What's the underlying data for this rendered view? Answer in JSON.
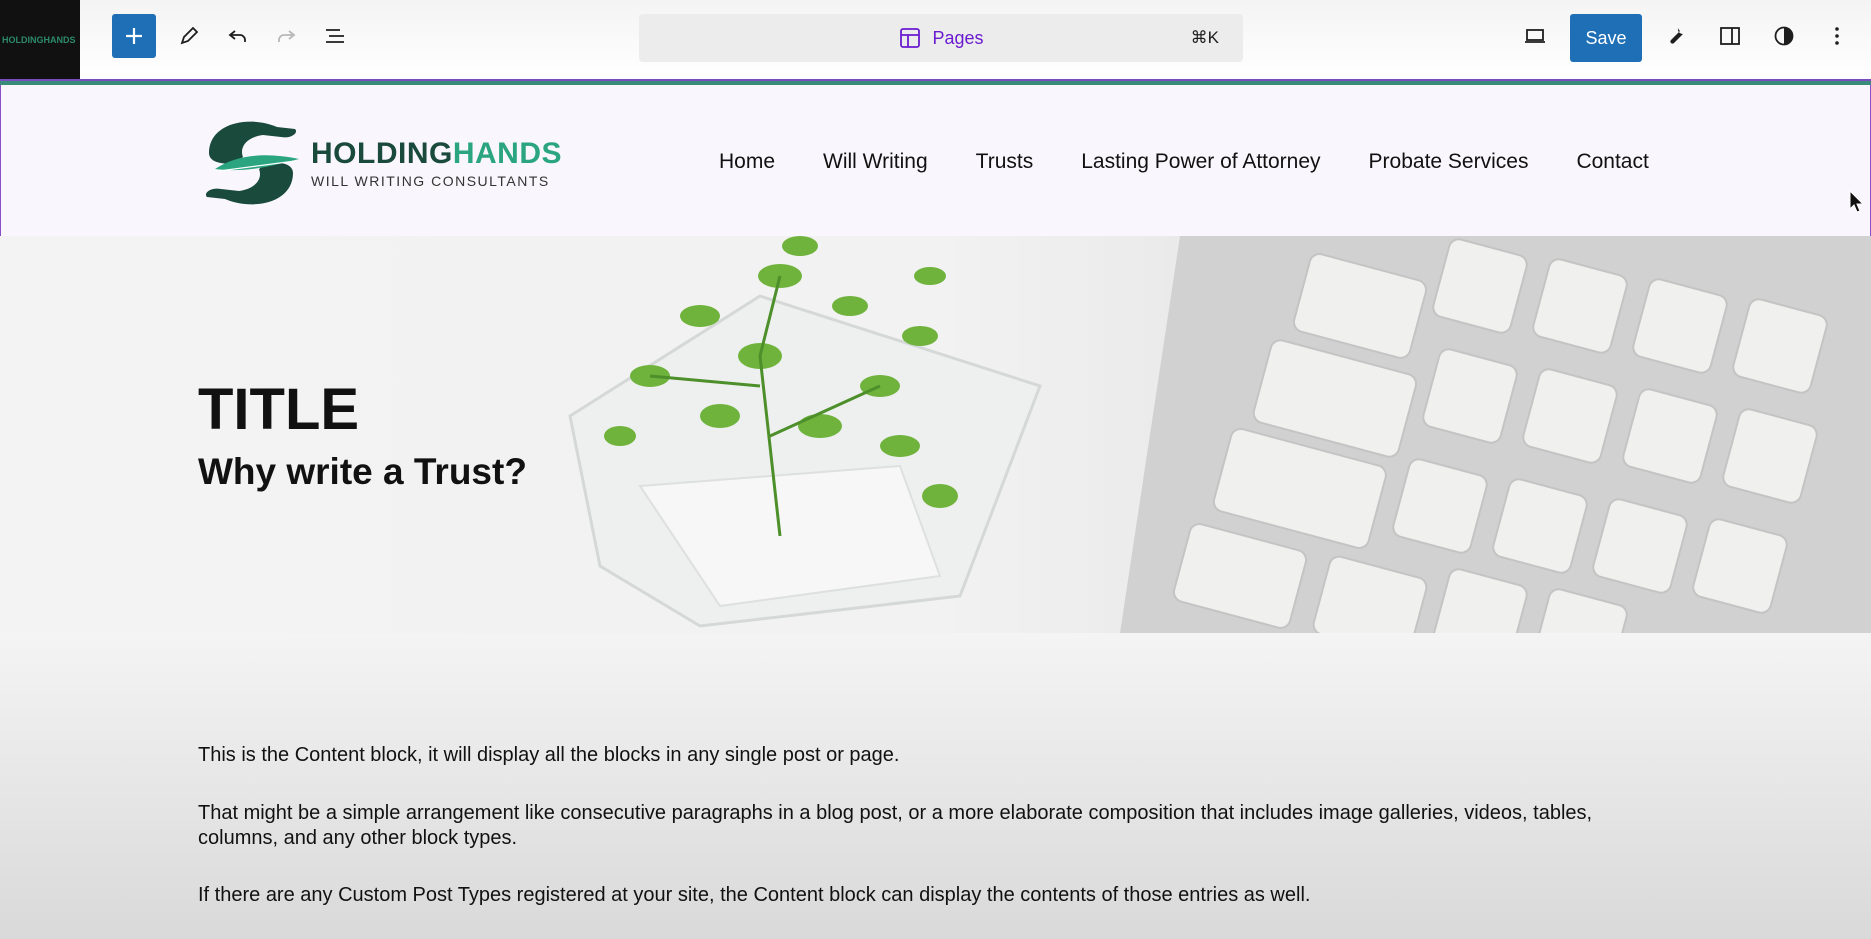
{
  "toolbar": {
    "site_thumb_text": "HOLDINGHANDS",
    "add_icon": "plus-icon",
    "tools_icon": "pencil-icon",
    "undo_icon": "undo-icon",
    "redo_icon": "redo-icon",
    "list_view_icon": "list-view-icon",
    "command": {
      "icon": "layout-icon",
      "label": "Pages",
      "shortcut": "⌘K"
    },
    "view_icon": "laptop-icon",
    "save_label": "Save",
    "tools_settings_icon": "wrench-icon",
    "sidebar_icon": "sidebar-toggle-icon",
    "styles_icon": "contrast-icon",
    "options_icon": "more-vertical-icon"
  },
  "site_header": {
    "logo": {
      "brand_part1": "HOLDING",
      "brand_part2": "HANDS",
      "tagline": "WILL WRITING CONSULTANTS"
    },
    "nav": [
      "Home",
      "Will Writing",
      "Trusts",
      "Lasting Power of Attorney",
      "Probate Services",
      "Contact"
    ]
  },
  "hero": {
    "title": "TITLE",
    "subtitle": "Why write a Trust?"
  },
  "content": {
    "paragraphs": [
      "This is the Content block, it will display all the blocks in any single post or page.",
      "That might be a simple arrangement like consecutive paragraphs in a blog post, or a more elaborate composition that includes image galleries, videos, tables, columns, and any other block types.",
      "If there are any Custom Post Types registered at your site, the Content block can display the contents of those entries as well."
    ]
  },
  "colors": {
    "accent_blue": "#1f6fb6",
    "command_purple": "#6a1bd0",
    "brand_dark_green": "#1a4a3b",
    "brand_green": "#2aa57f"
  }
}
